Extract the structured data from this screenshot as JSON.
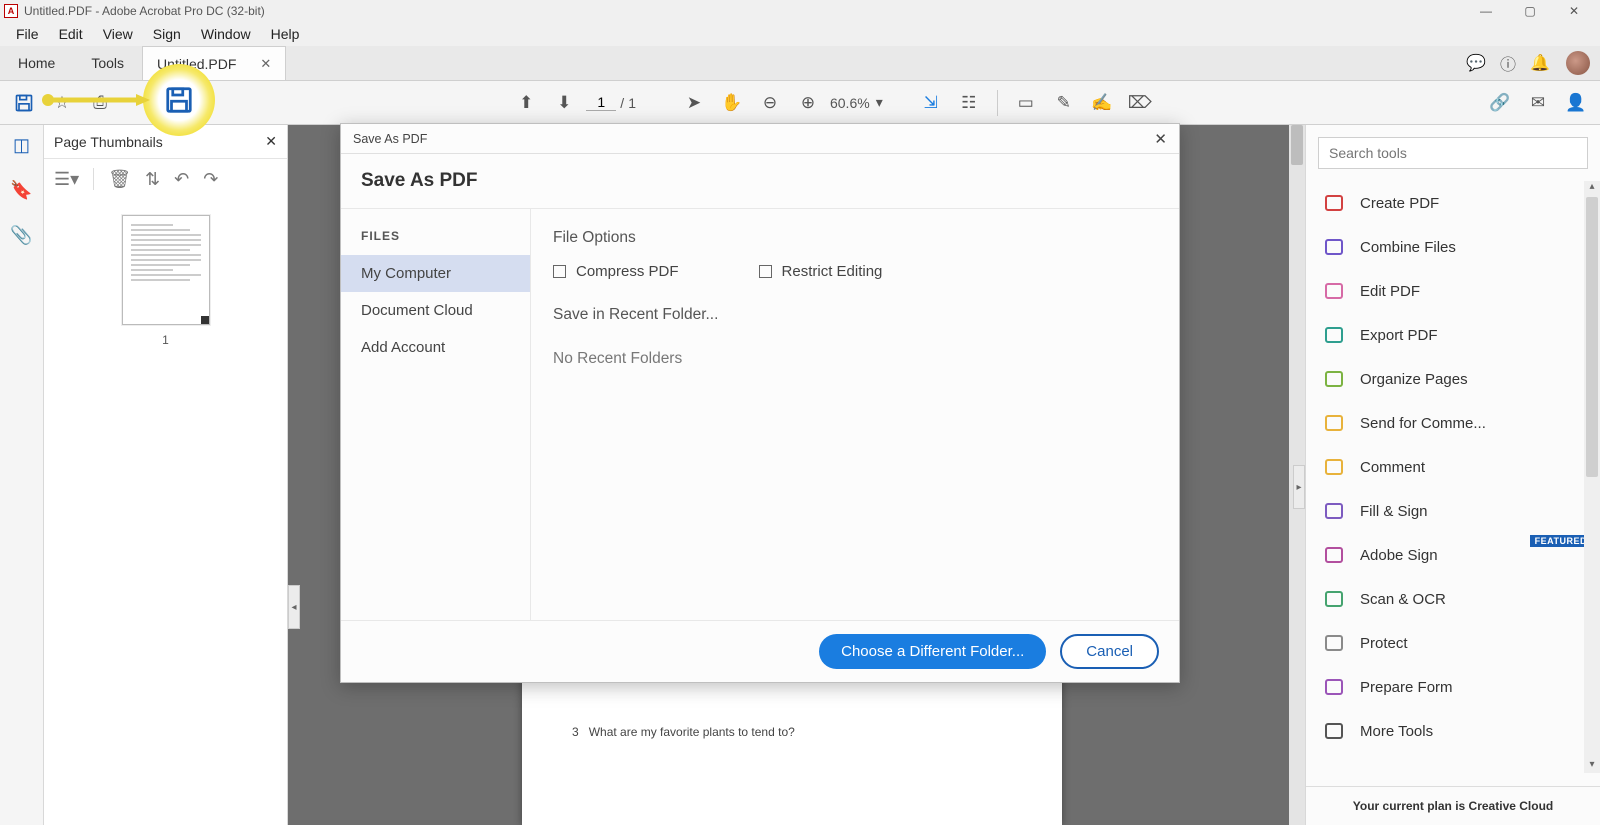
{
  "titlebar": {
    "title": "Untitled.PDF - Adobe Acrobat Pro DC (32-bit)"
  },
  "menubar": [
    "File",
    "Edit",
    "View",
    "Sign",
    "Window",
    "Help"
  ],
  "tabs": {
    "home": "Home",
    "tools": "Tools",
    "doc": "Untitled.PDF"
  },
  "toolbar": {
    "page_current": "1",
    "page_total": "1",
    "zoom": "60.6%"
  },
  "nav": {
    "title": "Page Thumbnails",
    "thumb_number": "1"
  },
  "doc_page": {
    "question_number": "3",
    "question_text": "What are my favorite plants to tend to?"
  },
  "right": {
    "search_placeholder": "Search tools",
    "items": [
      {
        "label": "Create PDF",
        "color": "#d24141"
      },
      {
        "label": "Combine Files",
        "color": "#6f56c9"
      },
      {
        "label": "Edit PDF",
        "color": "#d66aa6"
      },
      {
        "label": "Export PDF",
        "color": "#2e9e8f"
      },
      {
        "label": "Organize Pages",
        "color": "#7cb342"
      },
      {
        "label": "Send for Comme...",
        "color": "#e8b23b"
      },
      {
        "label": "Comment",
        "color": "#e8b23b"
      },
      {
        "label": "Fill & Sign",
        "color": "#7d5bc0"
      },
      {
        "label": "Adobe Sign",
        "color": "#b24f9e",
        "badge": "FEATURED"
      },
      {
        "label": "Scan & OCR",
        "color": "#45a36f"
      },
      {
        "label": "Protect",
        "color": "#8a8a8a"
      },
      {
        "label": "Prepare Form",
        "color": "#9b55b8"
      },
      {
        "label": "More Tools",
        "color": "#555"
      }
    ],
    "footer": "Your current plan is Creative Cloud"
  },
  "modal": {
    "title": "Save As PDF",
    "heading": "Save As PDF",
    "files_label": "FILES",
    "locations": [
      "My Computer",
      "Document Cloud",
      "Add Account"
    ],
    "file_options_label": "File Options",
    "opt_compress": "Compress PDF",
    "opt_restrict": "Restrict Editing",
    "recent_label": "Save in Recent Folder...",
    "no_recent": "No Recent Folders",
    "choose_btn": "Choose a Different Folder...",
    "cancel_btn": "Cancel"
  }
}
